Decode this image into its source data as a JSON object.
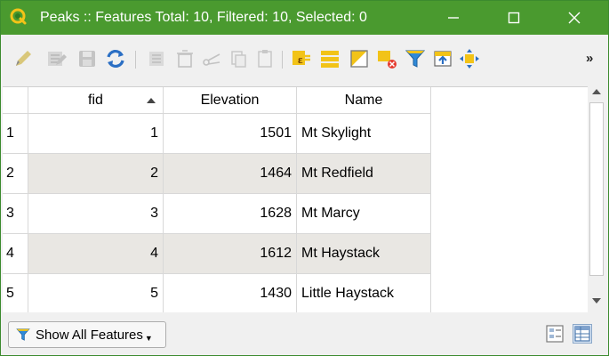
{
  "window": {
    "title": "Peaks :: Features Total: 10, Filtered: 10, Selected: 0"
  },
  "toolbar": {
    "items": [
      {
        "icon": "pencil-icon",
        "enabled": false
      },
      {
        "icon": "multi-edit-icon",
        "enabled": false
      },
      {
        "icon": "save-icon",
        "enabled": false
      },
      {
        "icon": "reload-icon",
        "enabled": true
      },
      {
        "icon": "add-feature-icon",
        "enabled": false
      },
      {
        "icon": "delete-icon",
        "enabled": false
      },
      {
        "icon": "cut-icon",
        "enabled": false
      },
      {
        "icon": "copy-icon",
        "enabled": false
      },
      {
        "icon": "paste-icon",
        "enabled": false
      },
      {
        "icon": "expression-select-icon",
        "enabled": true
      },
      {
        "icon": "select-all-icon",
        "enabled": true
      },
      {
        "icon": "invert-selection-icon",
        "enabled": true
      },
      {
        "icon": "deselect-icon",
        "enabled": true
      },
      {
        "icon": "filter-icon",
        "enabled": true
      },
      {
        "icon": "move-selection-top-icon",
        "enabled": true
      },
      {
        "icon": "pan-to-selection-icon",
        "enabled": true
      }
    ],
    "overflow_label": "»"
  },
  "table": {
    "columns": [
      {
        "label": "fid",
        "sorted": "ascending"
      },
      {
        "label": "Elevation"
      },
      {
        "label": "Name"
      }
    ],
    "rows": [
      {
        "num": "1",
        "fid": "1",
        "elevation": "1501",
        "name": "Mt Skylight"
      },
      {
        "num": "2",
        "fid": "2",
        "elevation": "1464",
        "name": "Mt Redfield"
      },
      {
        "num": "3",
        "fid": "3",
        "elevation": "1628",
        "name": "Mt Marcy"
      },
      {
        "num": "4",
        "fid": "4",
        "elevation": "1612",
        "name": "Mt Haystack"
      },
      {
        "num": "5",
        "fid": "5",
        "elevation": "1430",
        "name": "Little Haystack"
      }
    ]
  },
  "bottom": {
    "show_features_label": "Show All Features"
  },
  "colors": {
    "titlebar": "#4a9a2f",
    "row_alt": "#e9e7e3",
    "accent_yellow": "#f2c318"
  }
}
